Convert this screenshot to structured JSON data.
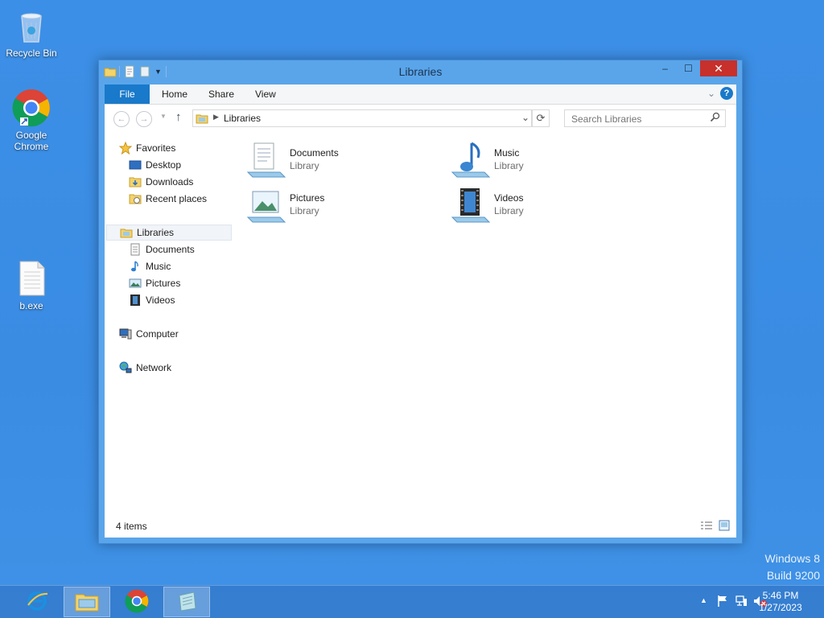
{
  "desktop": {
    "icons": [
      {
        "label": "Recycle Bin"
      },
      {
        "label": "Google Chrome"
      },
      {
        "label": "b.exe"
      }
    ],
    "watermark": {
      "line1": "Windows 8",
      "line2": "Build 9200"
    }
  },
  "window": {
    "title": "Libraries",
    "controls": {
      "minimize": "–",
      "maximize": "☐",
      "close": "✕"
    },
    "ribbon": {
      "tabs": [
        {
          "label": "File"
        },
        {
          "label": "Home"
        },
        {
          "label": "Share"
        },
        {
          "label": "View"
        }
      ]
    },
    "address": {
      "path": "Libraries"
    },
    "search": {
      "placeholder": "Search Libraries"
    },
    "navpane": {
      "favorites": {
        "label": "Favorites",
        "items": [
          {
            "label": "Desktop"
          },
          {
            "label": "Downloads"
          },
          {
            "label": "Recent places"
          }
        ]
      },
      "libraries": {
        "label": "Libraries",
        "items": [
          {
            "label": "Documents"
          },
          {
            "label": "Music"
          },
          {
            "label": "Pictures"
          },
          {
            "label": "Videos"
          }
        ]
      },
      "computer": {
        "label": "Computer"
      },
      "network": {
        "label": "Network"
      }
    },
    "content": {
      "items": [
        {
          "name": "Documents",
          "type": "Library"
        },
        {
          "name": "Music",
          "type": "Library"
        },
        {
          "name": "Pictures",
          "type": "Library"
        },
        {
          "name": "Videos",
          "type": "Library"
        }
      ]
    },
    "status": {
      "count": "4 items"
    }
  },
  "taskbar": {
    "clock": {
      "time": "5:46 PM",
      "date": "1/27/2023"
    }
  }
}
